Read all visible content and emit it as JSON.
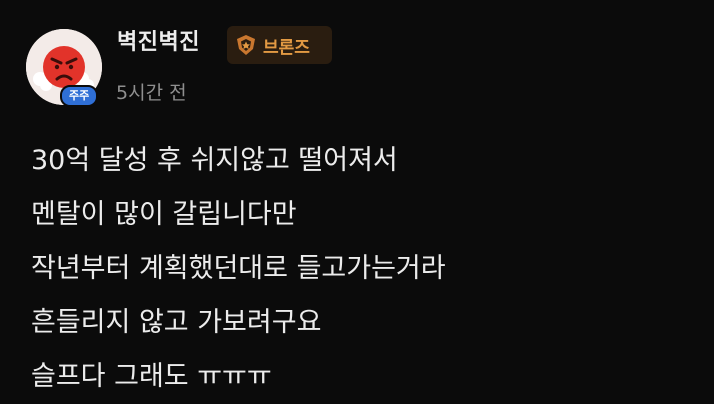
{
  "author": {
    "name": "벽진벽진",
    "rank_badge": "브론즈",
    "avatar_tag": "주주",
    "avatar_icon": "angry-face-avatar-icon",
    "rank_icon": "bronze-rank-icon"
  },
  "post": {
    "timestamp": "5시간 전",
    "lines": [
      "30억 달성 후 쉬지않고 떨어져서",
      "멘탈이 많이 갈립니다만",
      "작년부터 계획했던대로 들고가는거라",
      "흔들리지 않고 가보려구요",
      "슬프다 그래도 ㅠㅠㅠ"
    ]
  },
  "colors": {
    "background": "#0b0b0b",
    "rank_accent": "#e39a43",
    "avatar_tag_bg": "#2f6fd6"
  }
}
